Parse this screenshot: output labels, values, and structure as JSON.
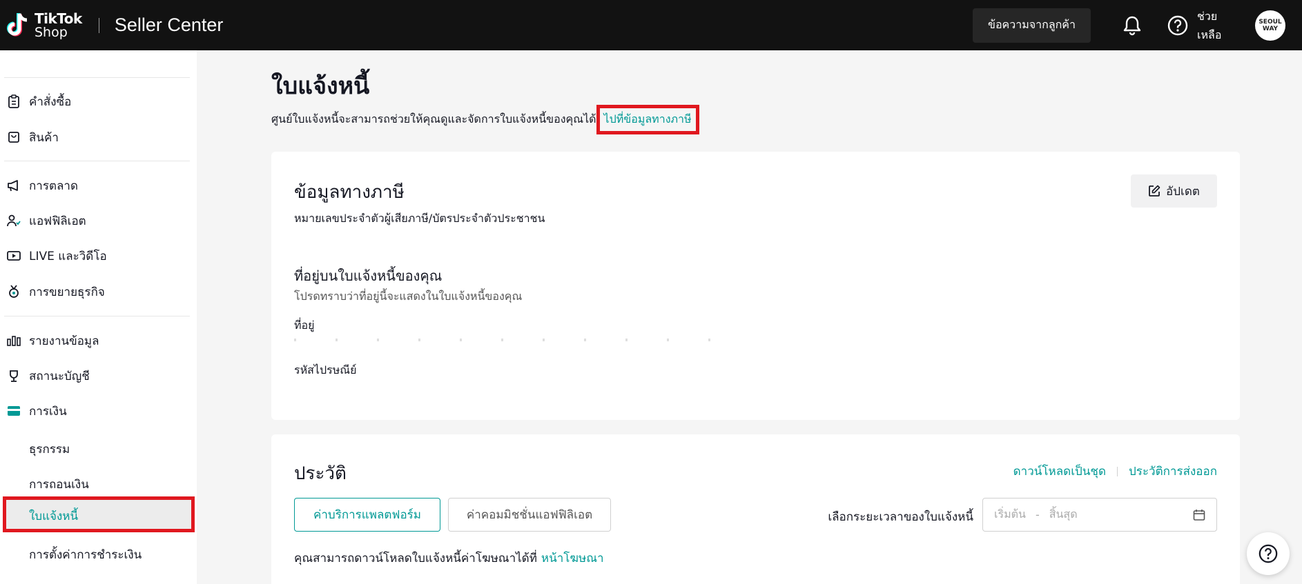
{
  "topbar": {
    "logo_line1": "TikTok",
    "logo_line2": "Shop",
    "app_title": "Seller Center",
    "messages_button": "ข้อความจากลูกค้า",
    "help_label": "ช่วยเหลือ",
    "avatar_text": "SEOUL WAY"
  },
  "sidebar": {
    "items": [
      {
        "label": "คำสั่งซื้อ",
        "icon": "clipboard-icon"
      },
      {
        "label": "สินค้า",
        "icon": "shopping-bag-icon"
      },
      {
        "label": "การตลาด",
        "icon": "megaphone-icon"
      },
      {
        "label": "แอฟฟิลิเอต",
        "icon": "users-icon"
      },
      {
        "label": "LIVE และวิดีโอ",
        "icon": "video-icon"
      },
      {
        "label": "การขยายธุรกิจ",
        "icon": "medal-icon"
      },
      {
        "label": "รายงานข้อมูล",
        "icon": "bar-chart-icon"
      },
      {
        "label": "สถานะบัญชี",
        "icon": "trophy-icon"
      },
      {
        "label": "การเงิน",
        "icon": "wallet-icon"
      }
    ],
    "sub_items": [
      "ธุรกรรม",
      "การถอนเงิน",
      "ใบแจ้งหนี้",
      "การตั้งค่าการชำระเงิน"
    ]
  },
  "main": {
    "title": "ใบแจ้งหนี้",
    "description": "ศูนย์ใบแจ้งหนี้จะสามารถช่วยให้คุณดูและจัดการใบแจ้งหนี้ของคุณได้",
    "tax_link": "ไปที่ข้อมูลทางภาษี"
  },
  "tax_card": {
    "title": "ข้อมูลทางภาษี",
    "update_button": "อัปเดต",
    "tax_id_label": "หมายเลขประจำตัวผู้เสียภาษี/บัตรประจำตัวประชาชน",
    "address_title": "ที่อยู่บนใบแจ้งหนี้ของคุณ",
    "address_note": "โปรดทราบว่าที่อยู่นี้จะแสดงในใบแจ้งหนี้ของคุณ",
    "address_label": "ที่อยู่",
    "postal_label": "รหัสไปรษณีย์"
  },
  "history_card": {
    "title": "ประวัติ",
    "bulk_download": "ดาวน์โหลดเป็นชุด",
    "export_history": "ประวัติการส่งออก",
    "tab_platform": "ค่าบริการแพลตฟอร์ม",
    "tab_affiliate": "ค่าคอมมิชชั่นแอฟฟิลิเอต",
    "period_label": "เลือกระยะเวลาของใบแจ้งหนี้",
    "date_start_placeholder": "เริ่มต้น",
    "date_sep": "-",
    "date_end_placeholder": "สิ้นสุด",
    "ad_note": "คุณสามารถดาวน์โหลดใบแจ้งหนี้ค่าโฆษณาได้ที่",
    "ad_link": "หน้าโฆษณา"
  },
  "colors": {
    "accent": "#009995",
    "highlight": "#e0181f",
    "topbar": "#121212"
  }
}
